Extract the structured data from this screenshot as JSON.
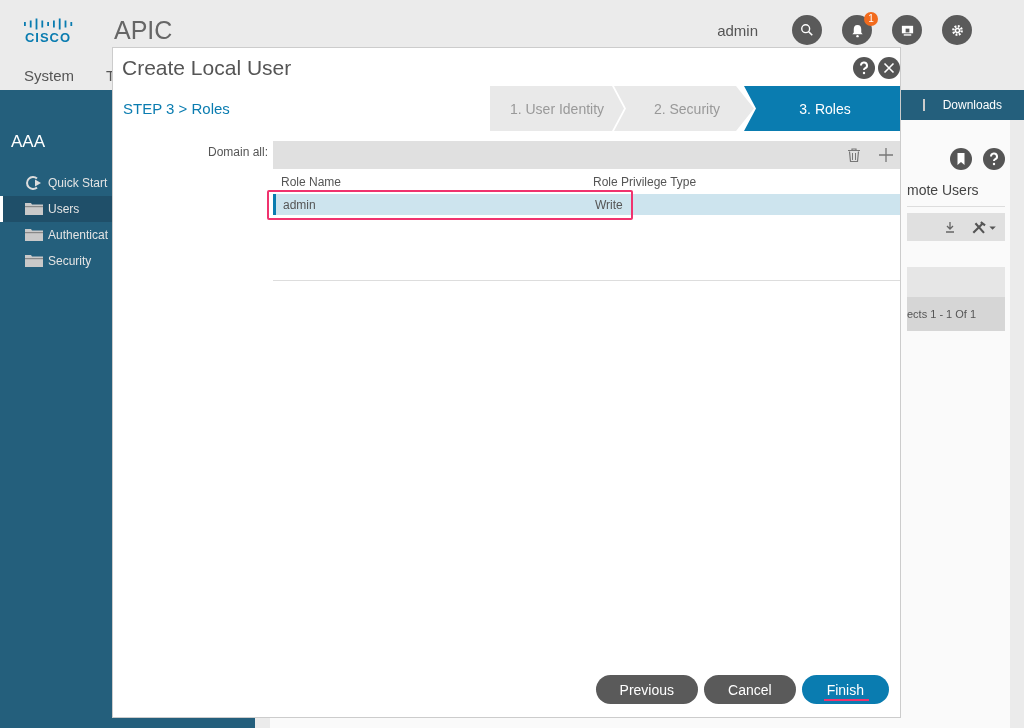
{
  "header": {
    "logo": "CISCO",
    "app_title": "APIC",
    "user": "admin",
    "notification_count": "1"
  },
  "nav": [
    "System",
    "T"
  ],
  "subnav": [
    "Downloads"
  ],
  "sidebar": {
    "title": "AAA",
    "items": [
      {
        "label": "Quick Start",
        "kind": "quickstart",
        "selected": false
      },
      {
        "label": "Users",
        "kind": "folder",
        "selected": true
      },
      {
        "label": "Authenticat",
        "kind": "folder",
        "selected": false
      },
      {
        "label": "Security",
        "kind": "folder",
        "selected": false
      }
    ]
  },
  "panel": {
    "title": "mote Users",
    "pagination": "ects 1 - 1 Of 1"
  },
  "modal": {
    "title": "Create Local User",
    "step_label": "STEP 3 > Roles",
    "steps": [
      {
        "label": "1. User Identity",
        "selected": false
      },
      {
        "label": "2. Security",
        "selected": false
      },
      {
        "label": "3. Roles",
        "selected": true
      }
    ],
    "domain_label": "Domain all:",
    "columns": [
      "Role Name",
      "Role Privilege Type"
    ],
    "rows": [
      {
        "cells": [
          "admin",
          "Write"
        ],
        "selected": true,
        "highlighted": true
      }
    ],
    "buttons": [
      {
        "label": "Previous",
        "kind": "secondary",
        "underlined": false
      },
      {
        "label": "Cancel",
        "kind": "secondary",
        "underlined": false
      },
      {
        "label": "Finish",
        "kind": "primary",
        "underlined": true
      }
    ]
  }
}
